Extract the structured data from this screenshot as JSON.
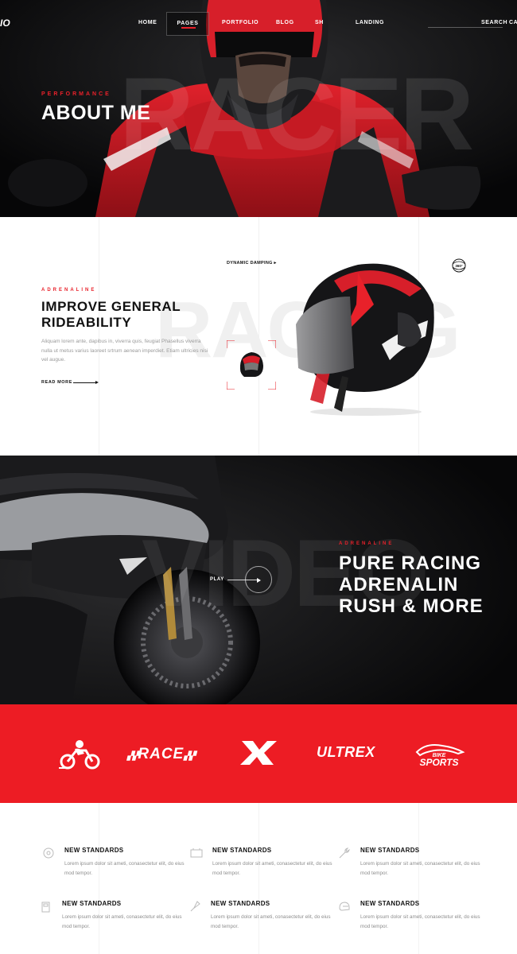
{
  "nav": {
    "logo": "IO",
    "items": [
      {
        "label": "HOME"
      },
      {
        "label": "PAGES"
      },
      {
        "label": "PORTFOLIO"
      },
      {
        "label": "BLOG"
      },
      {
        "label": "SH"
      },
      {
        "label": "LANDING"
      }
    ],
    "search_label": "SEARCH",
    "cart_label": "CA",
    "active_color": "#e8212a"
  },
  "hero": {
    "kicker": "PERFORMANCE",
    "title": "ABOUT ME",
    "background_word": "RACER"
  },
  "product": {
    "kicker": "ADRENALINE",
    "title_line1": "IMPROVE GENERAL",
    "title_line2": "RIDEABILITY",
    "description": "Aliquam lorem ante, dapibus in, viverra quis, feugiat Phasellus viverra nulla ut metus varius laoreet srtrum aenean imperdiet. Etiam ultricies nisi vel augue.",
    "read_more": "READ MORE",
    "hotspot_label": "DYNAMIC DAMPING",
    "badge_label": "360°",
    "background_word": "RACING"
  },
  "video": {
    "kicker": "ADRENALINE",
    "heading_lines": [
      "PURE RACING",
      "ADRENALIN",
      "RUSH & MORE"
    ],
    "play_label": "PLAY",
    "background_word": "VIDEO"
  },
  "brands": {
    "background_color": "#ed1c24",
    "logos": [
      {
        "name": "moto-logo"
      },
      {
        "name": "race-logo",
        "text": "RACE"
      },
      {
        "name": "x-logo"
      },
      {
        "name": "ultrex-logo",
        "text": "ULTREX"
      },
      {
        "name": "bike-sports-logo",
        "text_top": "BIKE",
        "text_bottom": "SPORTS"
      }
    ]
  },
  "features": [
    {
      "icon": "wheel-icon",
      "title": "NEW STANDARDS",
      "text": "Lorem ipsum dolor sit ameti, conasectetur elit, do eius mod tempor."
    },
    {
      "icon": "battery-icon",
      "title": "NEW STANDARDS",
      "text": "Lorem ipsum dolor sit ameti, conasectetur elit, do eius mod tempor."
    },
    {
      "icon": "wrench-icon",
      "title": "NEW STANDARDS",
      "text": "Lorem ipsum dolor sit ameti, conasectetur elit, do eius mod tempor."
    },
    {
      "icon": "fuel-icon",
      "title": "NEW STANDARDS",
      "text": "Lorem ipsum dolor sit ameti, conasectetur elit, do eius mod tempor."
    },
    {
      "icon": "spark-plug-icon",
      "title": "NEW STANDARDS",
      "text": "Lorem ipsum dolor sit ameti, conasectetur elit, do eius mod tempor."
    },
    {
      "icon": "helmet-outline-icon",
      "title": "NEW STANDARDS",
      "text": "Lorem ipsum dolor sit ameti, conasectetur elit, do eius mod tempor."
    }
  ]
}
